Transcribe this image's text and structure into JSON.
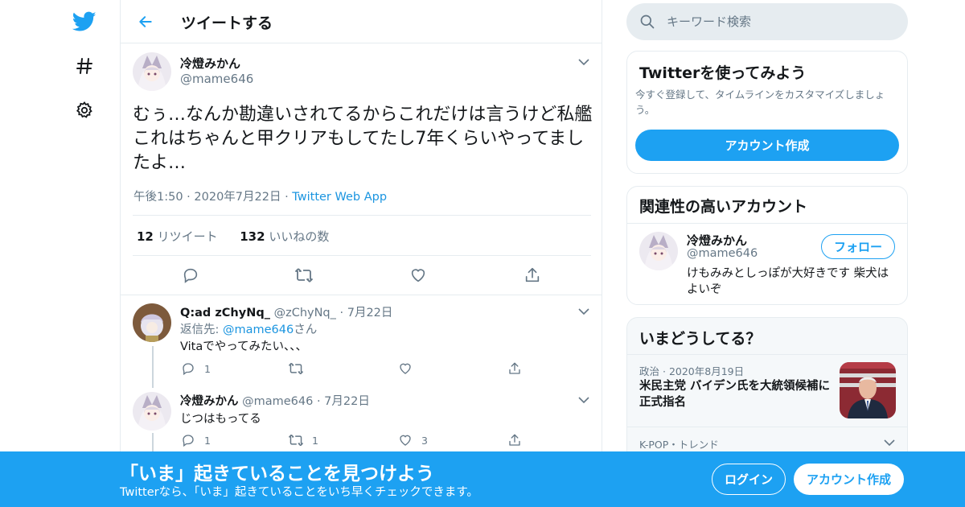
{
  "colors": {
    "brand": "#1da1f2",
    "link": "#1b95e0",
    "muted": "#657786",
    "border": "#e6ecf0"
  },
  "leftnav": {
    "icons": [
      "twitter-bird-icon",
      "hashtag-icon",
      "gear-icon"
    ]
  },
  "header": {
    "title": "ツイートする"
  },
  "main_tweet": {
    "name": "冷燈みかん",
    "handle": "@mame646",
    "text": "むぅ…なんか勘違いされてるからこれだけは言うけど私艦これはちゃんと甲クリアもしてたし7年くらいやってましたよ…",
    "time": "午後1:50",
    "date": "2020年7月22日",
    "app": "Twitter Web App",
    "retweet_count": "12",
    "retweet_label": "リツイート",
    "like_count": "132",
    "like_label": "いいねの数"
  },
  "replies": [
    {
      "name": "Q:ad zChyNq_",
      "handle": "@zChyNq_",
      "date": "7月22日",
      "reply_to_prefix": "返信先:",
      "reply_to_handle": "@mame646",
      "reply_to_suffix": "さん",
      "text": "Vitaでやってみたい、、、",
      "reply_count": "1",
      "retweet_count": "",
      "like_count": ""
    },
    {
      "name": "冷燈みかん",
      "handle": "@mame646",
      "date": "7月22日",
      "text": "じつはもってる",
      "reply_count": "1",
      "retweet_count": "1",
      "like_count": "3"
    }
  ],
  "search": {
    "placeholder": "キーワード検索"
  },
  "signup_card": {
    "title": "Twitterを使ってみよう",
    "description": "今すぐ登録して、タイムラインをカスタマイズしましょう。",
    "button": "アカウント作成"
  },
  "related_card": {
    "title": "関連性の高いアカウント",
    "name": "冷燈みかん",
    "handle": "@mame646",
    "bio": "けもみみとしっぽが大好きです 柴犬はよいぞ",
    "follow": "フォロー"
  },
  "trends_card": {
    "title": "いまどうしてる？",
    "item1_category": "政治",
    "item1_date": "2020年8月19日",
    "item1_headline": "米民主党 バイデン氏を大統領候補に正式指名",
    "item2_category": "K-POP・トレンド"
  },
  "banner": {
    "title": "「いま」起きていることを見つけよう",
    "subtitle": "Twitterなら、「いま」起きていることをいち早くチェックできます。",
    "login": "ログイン",
    "signup": "アカウント作成"
  }
}
